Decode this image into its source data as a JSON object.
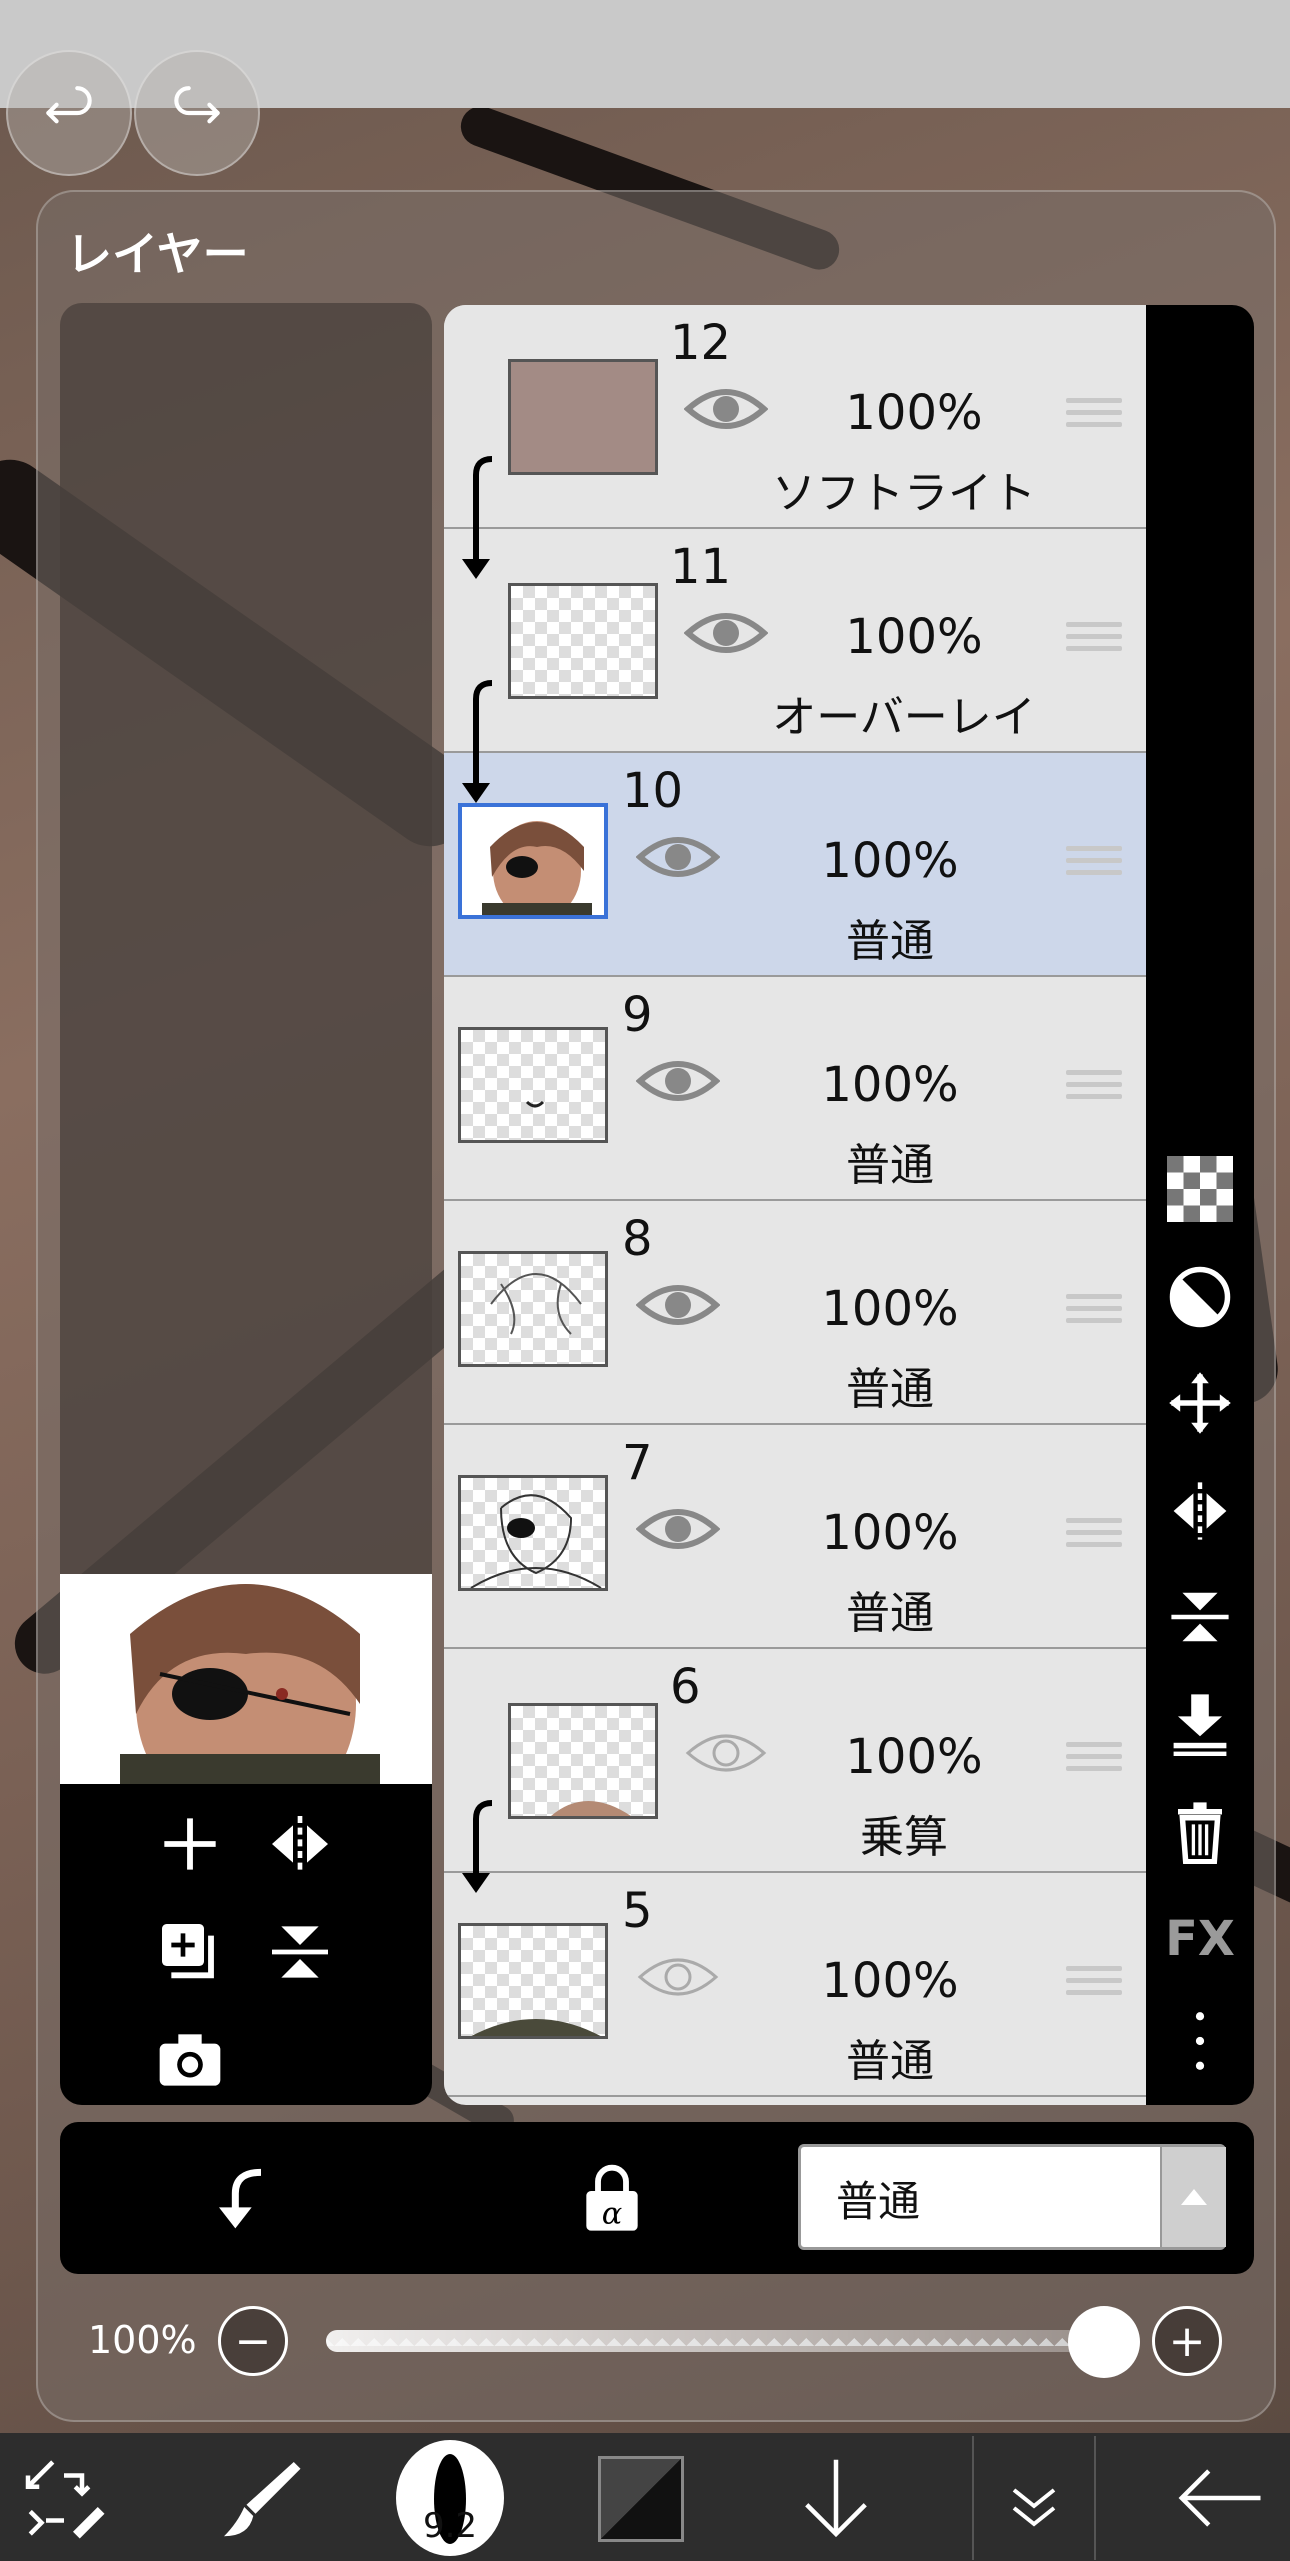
{
  "panel": {
    "title": "レイヤー"
  },
  "layers": [
    {
      "number": "12",
      "opacity": "100%",
      "mode": "ソフトライト",
      "visible": true,
      "clipped": true
    },
    {
      "number": "11",
      "opacity": "100%",
      "mode": "オーバーレイ",
      "visible": true,
      "clipped": true
    },
    {
      "number": "10",
      "opacity": "100%",
      "mode": "普通",
      "visible": true,
      "selected": true
    },
    {
      "number": "9",
      "opacity": "100%",
      "mode": "普通",
      "visible": true
    },
    {
      "number": "8",
      "opacity": "100%",
      "mode": "普通",
      "visible": true
    },
    {
      "number": "7",
      "opacity": "100%",
      "mode": "普通",
      "visible": true
    },
    {
      "number": "6",
      "opacity": "100%",
      "mode": "乗算",
      "visible": false,
      "clipped": true
    },
    {
      "number": "5",
      "opacity": "100%",
      "mode": "普通",
      "visible": false
    }
  ],
  "blend_mode": {
    "selected": "普通"
  },
  "opacity_slider": {
    "label": "100%",
    "value": 1.0,
    "minus": "−",
    "plus": "+"
  },
  "right_toolbar": {
    "fx_label": "FX"
  },
  "bottom_toolbar": {
    "brush_size": "9.2"
  },
  "colors": {
    "selected_row": "#cdd7ea",
    "selected_border": "#3a72d8",
    "toolbar_bg": "#000000"
  }
}
